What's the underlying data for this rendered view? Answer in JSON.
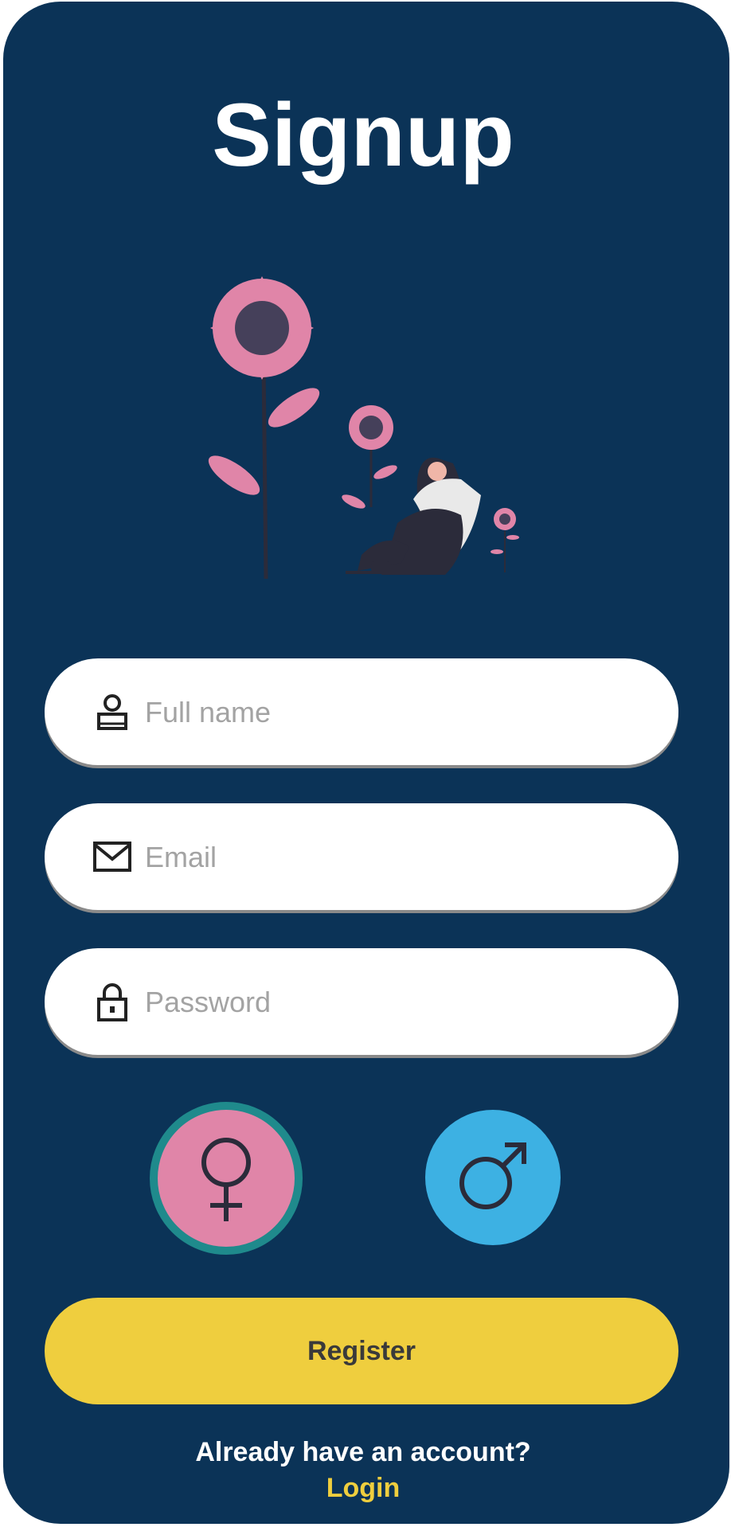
{
  "header": {
    "title": "Signup"
  },
  "form": {
    "full_name": {
      "placeholder": "Full name",
      "value": "",
      "icon": "user-icon"
    },
    "email": {
      "placeholder": "Email",
      "value": "",
      "icon": "mail-icon"
    },
    "password": {
      "placeholder": "Password",
      "value": "",
      "icon": "lock-icon"
    }
  },
  "gender": {
    "female": {
      "icon": "female-symbol-icon",
      "color": "#e085a8",
      "ring_color": "#1f8a8c",
      "selected": true
    },
    "male": {
      "icon": "male-symbol-icon",
      "color": "#3db1e3",
      "selected": false
    }
  },
  "actions": {
    "register_label": "Register",
    "already_text": "Already have an account?",
    "login_label": "Login"
  },
  "colors": {
    "background": "#0b3357",
    "accent": "#efce3e",
    "illustration_pink": "#e085a8"
  }
}
